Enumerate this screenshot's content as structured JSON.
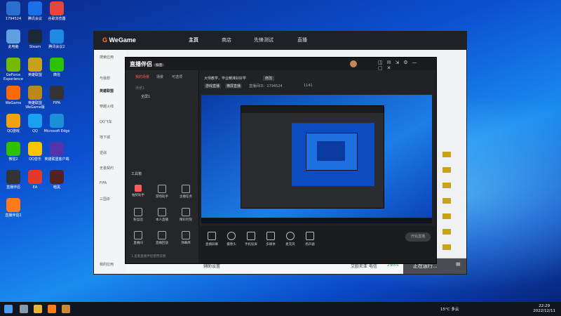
{
  "desktop": {
    "icons": [
      {
        "label": "1794524",
        "color": "#2b6fd0"
      },
      {
        "label": "腾讯会议",
        "color": "#1d6fe8"
      },
      {
        "label": "谷歌浏览器",
        "color": "#e9453a"
      },
      {
        "label": "此电脑",
        "color": "#5fa0e0"
      },
      {
        "label": "Steam",
        "color": "#1b2838"
      },
      {
        "label": "腾讯会议2",
        "color": "#1e88e5"
      },
      {
        "label": "GeForce Experience",
        "color": "#76b900"
      },
      {
        "label": "英雄联盟",
        "color": "#c8a21a"
      },
      {
        "label": "微信",
        "color": "#2dc100"
      },
      {
        "label": "WeGame",
        "color": "#ff6a00"
      },
      {
        "label": "英雄联盟WeGame版",
        "color": "#b88a1a"
      },
      {
        "label": "FIFA",
        "color": "#333333"
      },
      {
        "label": "QQ游戏",
        "color": "#f2a20c"
      },
      {
        "label": "QQ",
        "color": "#1aa0f0"
      },
      {
        "label": "Microsoft Edge",
        "color": "#1c8fd8"
      },
      {
        "label": "微信2",
        "color": "#2dc100"
      },
      {
        "label": "QQ音乐",
        "color": "#f7c600"
      },
      {
        "label": "英雄联盟客户端",
        "color": "#5533aa"
      },
      {
        "label": "直播伴侣",
        "color": "#333333"
      },
      {
        "label": "EA",
        "color": "#e23a2a"
      },
      {
        "label": "暗黑",
        "color": "#552222"
      },
      {
        "label": "直播伴侣2",
        "color": "#ff7a1a"
      }
    ]
  },
  "wegame": {
    "logo": "WeGame",
    "tabs": [
      "主页",
      "商店",
      "先锋测试",
      "直播"
    ],
    "sidebar": [
      "搜索应用",
      "与我想",
      "英雄联盟",
      "穿越火线",
      "QQ飞车",
      "地下城",
      "逆战",
      "无畏契约",
      "FIFA",
      "三国杀",
      "我的应用"
    ],
    "bottom": {
      "settings": "辅助设置",
      "status": "艾欧尼亚 电信",
      "badge": "29ms",
      "run_button": "正在运行..."
    }
  },
  "live": {
    "logo": "直播伴侣",
    "badge": "抖音",
    "left_tabs": [
      "我的场景",
      "场景",
      "可选项"
    ],
    "scene_label": "场景1",
    "scene_group": "全屏1",
    "tools_title": "工具箱",
    "tools": [
      {
        "label": "抽奖助手",
        "color": "#ff5a5a"
      },
      {
        "label": "游戏助手",
        "color": "#888888"
      },
      {
        "label": "主播任务",
        "color": "#888888"
      },
      {
        "label": "粉丝团",
        "color": "#888888"
      },
      {
        "label": "本人直播",
        "color": "#888888"
      },
      {
        "label": "精彩时刻",
        "color": "#888888"
      },
      {
        "label": "直播间",
        "color": "#888888"
      },
      {
        "label": "直播回放",
        "color": "#888888"
      },
      {
        "label": "弹幕库",
        "color": "#888888"
      }
    ],
    "footer_hint": "1.查看直播伴侣使用说明",
    "info": {
      "title": "大师教学，毕业精准好好学",
      "tag": "修改",
      "category": "游戏直播",
      "mode": "横屏直播",
      "room": "直播间ID：1794524",
      "likes": "1141"
    },
    "bottom_tools": [
      "直播屏幕",
      "摄像头",
      "手机投屏",
      "多媒体",
      "麦克风",
      "扬声器"
    ],
    "start_button": "开始直播"
  },
  "taskbar": {
    "weather": "15°C 多云",
    "time": "22:29",
    "date": "2022/12/11"
  }
}
